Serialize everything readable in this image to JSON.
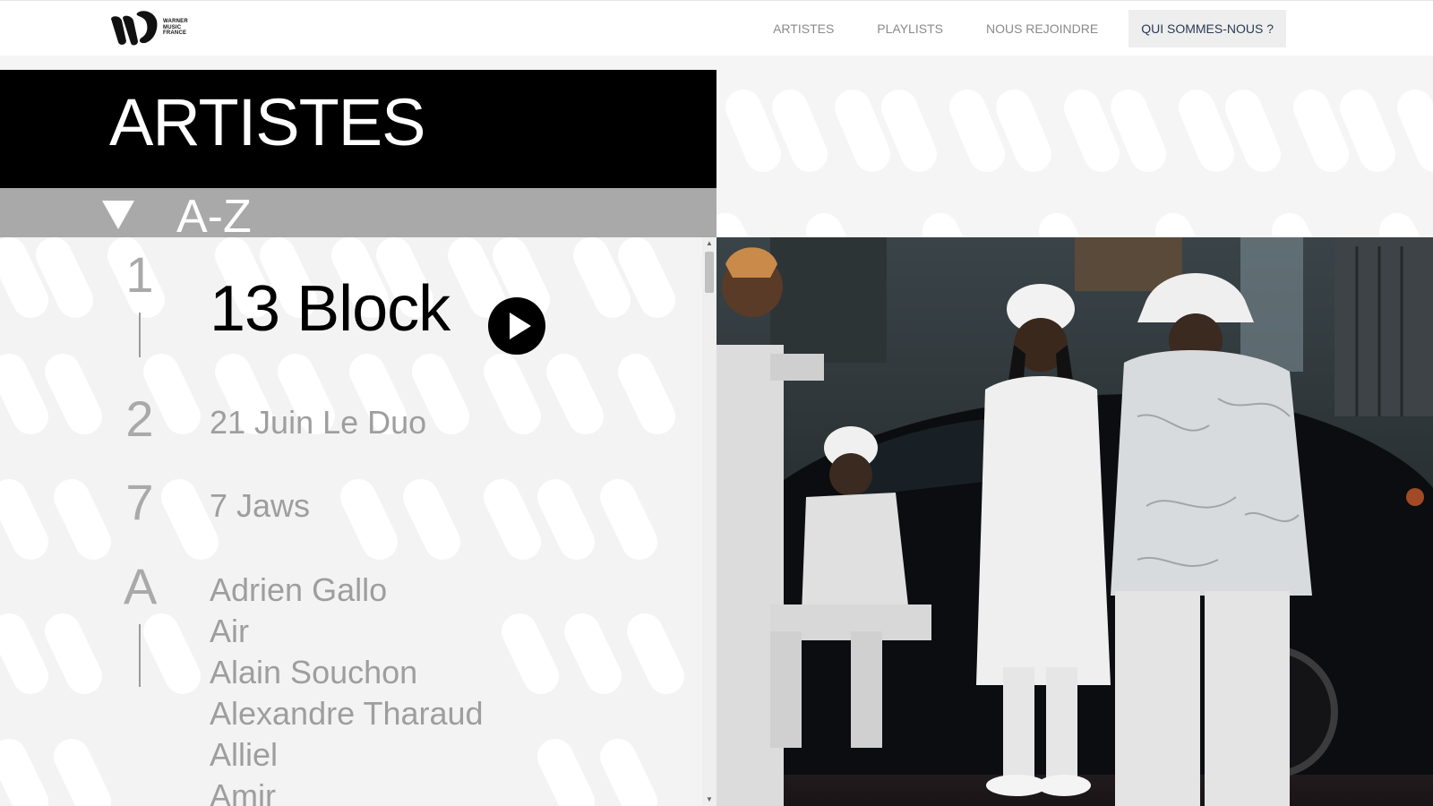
{
  "header": {
    "logo_lines": [
      "WARNER",
      "MUSIC",
      "FRANCE"
    ],
    "nav": [
      {
        "label": "ARTISTES"
      },
      {
        "label": "PLAYLISTS"
      },
      {
        "label": "NOUS REJOINDRE"
      },
      {
        "label": "QUI SOMMES-NOUS ?"
      }
    ]
  },
  "main": {
    "title": "ARTISTES",
    "filter_label": "A-Z"
  },
  "groups": [
    {
      "letter": "1",
      "artists": [
        "13 Block"
      ]
    },
    {
      "letter": "2",
      "artists": [
        "21 Juin Le Duo"
      ]
    },
    {
      "letter": "7",
      "artists": [
        "7 Jaws"
      ]
    },
    {
      "letter": "A",
      "artists": [
        "Adrien Gallo",
        "Air",
        "Alain Souchon",
        "Alexandre Tharaud",
        "Alliel",
        "Amir"
      ]
    }
  ],
  "colors": {
    "title_band": "#000000",
    "filter_band": "#a9a9a9",
    "artist_inactive": "#9e9e9e",
    "nav_active_text": "#2b3a55"
  },
  "icons": {
    "logo": "warner-music-logo",
    "filter": "triangle-down-icon",
    "play": "play-circle-icon"
  }
}
